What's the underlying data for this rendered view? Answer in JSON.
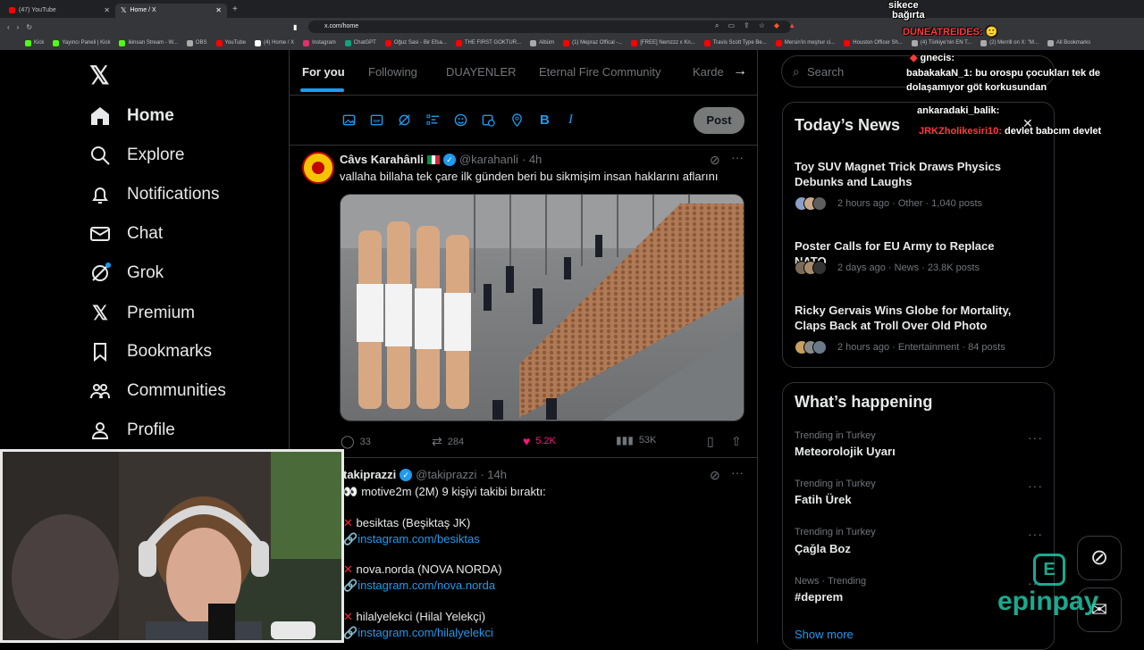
{
  "browser": {
    "tabs": [
      {
        "title": "(47) YouTube",
        "active": false
      },
      {
        "title": "Home / X",
        "active": true
      }
    ],
    "new_tab": "+",
    "url": "x.com/home",
    "bookmarks": [
      "Kick",
      "Yayıncı Paneli | Kick",
      "ikinsan Stream - W...",
      "OBS",
      "YouTube",
      "(4) Home / X",
      "Instagram",
      "ChatGPT",
      "Oğuz Sasi - Bir Efsa...",
      "THE FIRST GOKTUR...",
      "Albüm",
      "(1) Mepraz Offical -...",
      "[FREE] Nemzzz x Kn...",
      "Travis Scott Type Be...",
      "Mersin'in meşhur ci...",
      "Houston Officer Sh...",
      "(4) Türkiye'nin EN T...",
      "(2) Merrill on X: \"M...",
      "All Bookmarks"
    ]
  },
  "sidebar": {
    "items": [
      {
        "label": "Home",
        "icon": "home-icon"
      },
      {
        "label": "Explore",
        "icon": "search-icon"
      },
      {
        "label": "Notifications",
        "icon": "bell-icon"
      },
      {
        "label": "Chat",
        "icon": "mail-icon"
      },
      {
        "label": "Grok",
        "icon": "grok-icon"
      },
      {
        "label": "Premium",
        "icon": "x-logo-icon"
      },
      {
        "label": "Bookmarks",
        "icon": "bookmark-icon"
      },
      {
        "label": "Communities",
        "icon": "people-icon"
      },
      {
        "label": "Profile",
        "icon": "user-icon"
      }
    ]
  },
  "timeline": {
    "tabs": [
      "For you",
      "Following",
      "DUAYENLER",
      "Eternal Fire Community",
      "Karde"
    ],
    "post_button": "Post",
    "posts": [
      {
        "name": "Câvs Karahânli",
        "handle": "@karahanli",
        "time": "· 4h",
        "text": "vallaha billaha tek çare ilk günden beri bu sikmişim insan haklarını aflarını",
        "replies": "33",
        "reposts": "284",
        "likes": "5.2K",
        "views": "53K"
      },
      {
        "name": "takiprazzi",
        "handle": "@takiprazzi",
        "time": "· 14h",
        "text": "motive2m (2M) 9 kişiyi takibi bıraktı:",
        "items": [
          {
            "name": "besiktas (Beşiktaş JK)",
            "link": "instagram.com/besiktas"
          },
          {
            "name": "nova.norda (NOVA NORDA)",
            "link": "instagram.com/nova.norda"
          },
          {
            "name": "hilalyelekci (Hilal Yelekçi)",
            "link": "instagram.com/hilalyelekci"
          }
        ]
      }
    ]
  },
  "right": {
    "search_placeholder": "Search",
    "news_title": "Today’s News",
    "news": [
      {
        "title": "Toy SUV Magnet Trick Draws Physics Debunks and Laughs",
        "meta": "2 hours ago · Other · 1,040 posts"
      },
      {
        "title": "Poster Calls for EU Army to Replace NATO",
        "meta": "2 days ago · News · 23.8K posts"
      },
      {
        "title": "Ricky Gervais Wins Globe for Mortality, Claps Back at Troll Over Old Photo",
        "meta": "2 hours ago · Entertainment · 84 posts"
      }
    ],
    "happening_title": "What’s happening",
    "trends": [
      {
        "context": "Trending in Turkey",
        "topic": "Meteorolojik Uyarı"
      },
      {
        "context": "Trending in Turkey",
        "topic": "Fatih Ürek"
      },
      {
        "context": "Trending in Turkey",
        "topic": "Çağla Boz"
      },
      {
        "context": "News · Trending",
        "topic": "#deprem"
      }
    ],
    "show_more": "Show more"
  },
  "overlay": {
    "chat": [
      {
        "user": "sikece",
        "text": ""
      },
      {
        "user": "",
        "text": "bağırta"
      },
      {
        "user": "DUNEATREIDES:",
        "text": ""
      },
      {
        "user": "gnecis:",
        "text": ""
      },
      {
        "user": "babakakaN_1:",
        "text": "bu orospu çocukları tek de dolaşamıyor göt korkusundan"
      },
      {
        "user": "ankaradaki_balik:",
        "text": ""
      },
      {
        "user": "JRKZholikesiri10:",
        "text": "devlet babcım devlet"
      }
    ],
    "sponsor": "epinpay"
  },
  "colors": {
    "accent": "#1d9bf0",
    "like": "#f91880",
    "bg": "#000000",
    "border": "#2f3336",
    "muted": "#71767b"
  }
}
